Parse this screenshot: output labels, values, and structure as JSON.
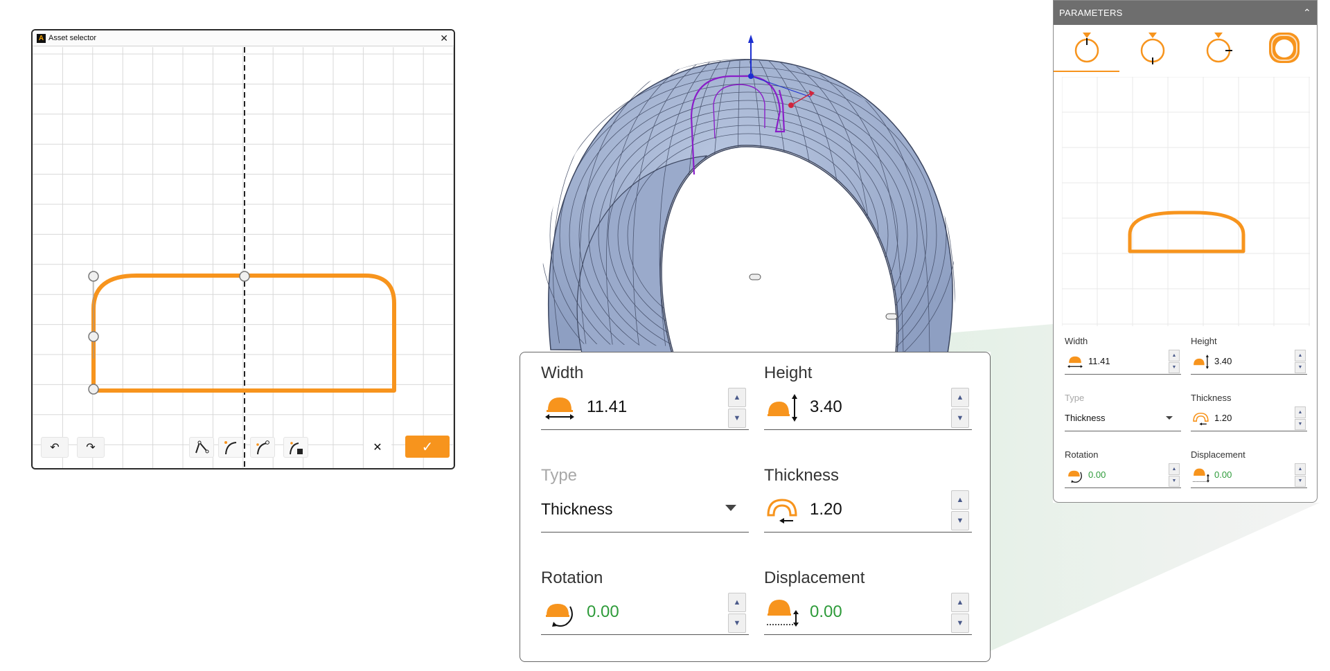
{
  "asset_selector": {
    "logo_glyph": "A",
    "title": "Asset selector",
    "close_glyph": "✕",
    "toolbar": {
      "undo_glyph": "↶",
      "redo_glyph": "↷",
      "cancel_glyph": "✕",
      "confirm_glyph": "✓"
    }
  },
  "parameters": {
    "title": "PARAMETERS",
    "collapse_glyph": "⌃",
    "fields": {
      "width": {
        "label": "Width",
        "value": "11.41"
      },
      "height": {
        "label": "Height",
        "value": "3.40"
      },
      "type": {
        "label": "Type",
        "value": "Thickness"
      },
      "thickness": {
        "label": "Thickness",
        "value": "1.20"
      },
      "rotation": {
        "label": "Rotation",
        "value": "0.00"
      },
      "displacement": {
        "label": "Displacement",
        "value": "0.00"
      }
    },
    "spinner": {
      "up": "▲",
      "down": "▼"
    }
  },
  "colors": {
    "accent": "#f7941d",
    "ring_fill": "#a4b4d2",
    "ring_lines": "#3c4660",
    "highlight_profile": "#8a1ec8",
    "green_value": "#2e9b3a",
    "header_gray": "#6e6e6e"
  }
}
